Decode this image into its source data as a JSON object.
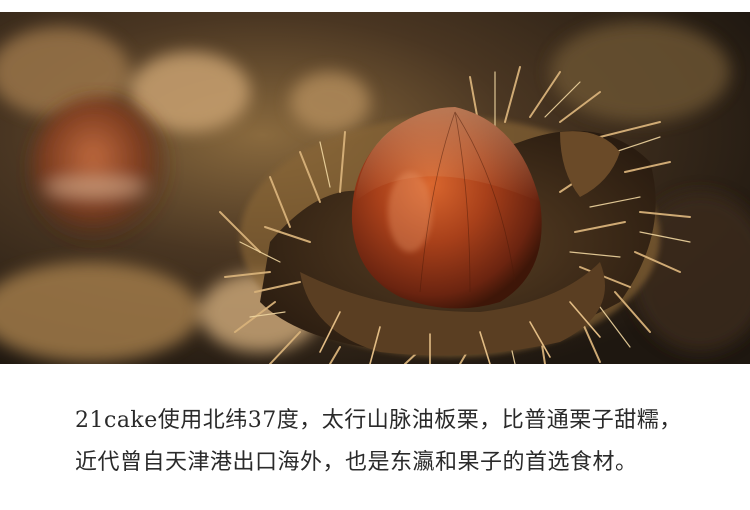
{
  "caption": {
    "line1": "21cake使用北纬37度，太行山脉油板栗，比普通栗子甜糯，",
    "line2": "近代曾自天津港出口海外，也是东瀛和果子的首选食材。"
  }
}
